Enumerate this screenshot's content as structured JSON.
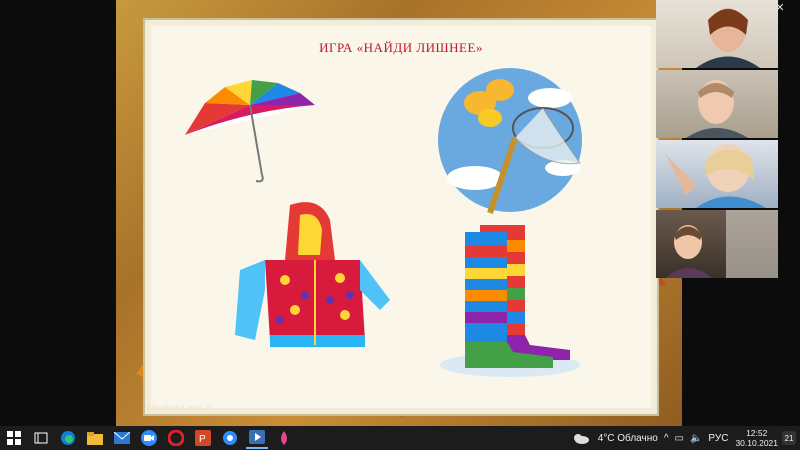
{
  "window": {
    "minimize": "—",
    "maximize": "❐",
    "close": "✕"
  },
  "slide": {
    "title": "ИГРА «НАЙДИ  ЛИШНЕЕ»",
    "watermark": "alenatarko.ucoz.ru",
    "items": [
      "umbrella",
      "butterfly-net",
      "jacket",
      "rain-boots"
    ]
  },
  "participants": [
    "participant-1",
    "participant-2",
    "participant-3",
    "participant-4"
  ],
  "taskbar": {
    "apps": [
      "start-icon",
      "task-view-icon",
      "edge-icon",
      "file-explorer-icon",
      "mail-icon",
      "zoom-icon",
      "opera-icon",
      "powerpoint-icon",
      "chrome-icon",
      "media-player-icon",
      "paint-icon"
    ],
    "weather": "4°C  Облачно",
    "language": "РУС",
    "time": "12:52",
    "date": "30.10.2021",
    "notifications": "21"
  },
  "colors": {
    "title": "#c0182c",
    "taskbar": "#1c1c1c"
  }
}
